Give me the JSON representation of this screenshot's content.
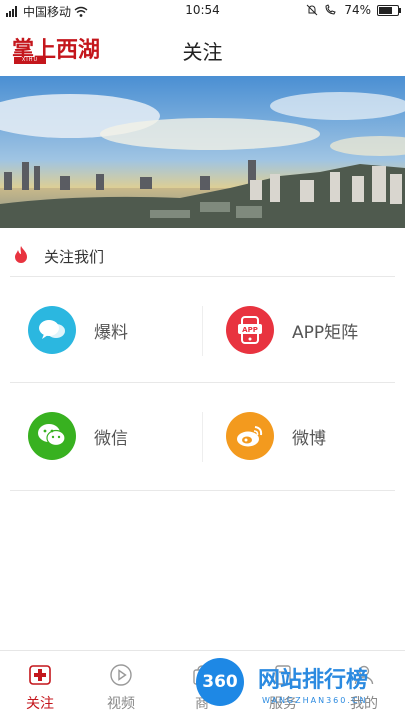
{
  "status_bar": {
    "carrier": "中国移动",
    "time": "10:54",
    "battery": "74%",
    "battery_level": 0.74
  },
  "header": {
    "logo_text": "掌上西湖",
    "logo_sub": "XIHU",
    "title": "关注"
  },
  "section": {
    "title": "关注我们"
  },
  "grid": [
    {
      "label": "爆料",
      "icon": "chat-bubbles-icon",
      "color": "#2bb7e0"
    },
    {
      "label": "APP矩阵",
      "icon": "app-phone-icon",
      "color": "#e8333f"
    },
    {
      "label": "微信",
      "icon": "wechat-icon",
      "color": "#38b120"
    },
    {
      "label": "微博",
      "icon": "weibo-icon",
      "color": "#f39a1e"
    }
  ],
  "tabs": [
    {
      "label": "关注",
      "icon": "red-cross-icon",
      "active": true
    },
    {
      "label": "视频",
      "icon": "play-icon",
      "active": false
    },
    {
      "label": "商",
      "icon": "shop-icon",
      "active": false
    },
    {
      "label": "服务",
      "icon": "service-icon",
      "active": false
    },
    {
      "label": "我的",
      "icon": "user-icon",
      "active": false
    }
  ],
  "watermark": {
    "badge": "360",
    "title": "网站排行榜",
    "subtitle": "WANGZHAN360.CN"
  },
  "colors": {
    "brand_red": "#c4161c",
    "tab_inactive": "#888888"
  }
}
